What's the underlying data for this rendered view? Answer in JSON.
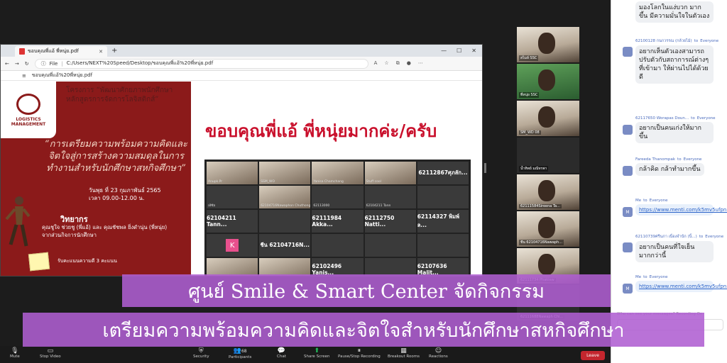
{
  "browser": {
    "tab_title": "ขอบคุณพี่แอ้ พี่หนุ่ย.pdf",
    "address_prefix": "File",
    "address_path": "C:/Users/NEXT%20Speed/Desktop/ขอบคุณพี่แอ้%20พี่หนุ่ย.pdf",
    "pdf_filename": "ขอบคุณพี่แอ้%20พี่หนุ่ย.pdf"
  },
  "slide": {
    "logo_text": "LOGISTICS MANAGEMENT",
    "project_line1": "โครงการ “พัฒนาศักยภาพนักศึกษา",
    "project_line2": "หลักสูตรการจัดการโลจิสติกส์”",
    "event_title": "“การเตรียมความพร้อมความคิดและจิตใจสู่การสร้างความสมดุลในการทำงานสำหรับนักศึกษาสหกิจศึกษา”",
    "date_line1": "วันพุธ ที่ 23 กุมภาพันธ์ 2565",
    "date_line2": "เวลา 09.00-12.00 น.",
    "speaker_label": "วิทยากร",
    "speaker_names": "คุณชูใจ ช่วยชู (พี่แอ้) และ คุณชัชพล ยิ่งดำนุ่น (พี่หนุ่ย)",
    "speaker_org": "จากส่วนกิจการนักศึกษา",
    "cert_text": "รับคะแนนความดี 3 คะแนน",
    "thanks_text": "ขอบคุณพี่แอ้ พี่หนุ่ยมากค่ะ/ครับ"
  },
  "gallery": [
    {
      "label": "Anupk.Pr",
      "kind": "cam"
    },
    {
      "label": "SSM_WO",
      "kind": "cam"
    },
    {
      "label": "Yanisa Chamchang",
      "kind": "cam"
    },
    {
      "label": "Stuff cool",
      "kind": "cam"
    },
    {
      "label": "62112867ศุภลัก...",
      "kind": "text"
    },
    {
      "label": "เอ้ซัม",
      "kind": "dark"
    },
    {
      "label": "62104716Nawaphon Chuthong",
      "kind": "cam"
    },
    {
      "label": "62113000",
      "kind": "dark"
    },
    {
      "label": "62104211 Tann",
      "kind": "dark"
    },
    {
      "label": "",
      "kind": "dark"
    },
    {
      "label": "62104211 Tann...",
      "kind": "text"
    },
    {
      "label": "",
      "kind": "dark"
    },
    {
      "label": "62111984 Akka...",
      "kind": "text"
    },
    {
      "label": "62112750 Natti...",
      "kind": "text"
    },
    {
      "label": "62114327 พิมพ์ล...",
      "kind": "text"
    },
    {
      "label": "K",
      "kind": "k"
    },
    {
      "label": "ชีน 62104716N...",
      "kind": "text"
    },
    {
      "label": "",
      "kind": "dark"
    },
    {
      "label": "",
      "kind": "dark"
    },
    {
      "label": "",
      "kind": "dark"
    },
    {
      "label": "",
      "kind": "cam"
    },
    {
      "label": "",
      "kind": "cam"
    },
    {
      "label": "62102496 Yanis...",
      "kind": "text"
    },
    {
      "label": "",
      "kind": "dark"
    },
    {
      "label": "62107636 Malit...",
      "kind": "text"
    }
  ],
  "video_strip": [
    {
      "name": "สไมล์ SSC",
      "kind": "cam"
    },
    {
      "name": "พี่หนุ่ย SSC",
      "kind": "green"
    },
    {
      "name": "SM_WD 08",
      "kind": "cam"
    },
    {
      "name": "น้ำทิพย์ มณีทรพา",
      "kind": "dark"
    },
    {
      "name": "62111584Sireena Ta...",
      "kind": "cam"
    },
    {
      "name": "ชีน 62104716Nawaph...",
      "kind": "cam"
    },
    {
      "name": "62111734 Phakiew",
      "kind": "cam"
    },
    {
      "name": "62111688Nawaph Chi...",
      "kind": "dark"
    }
  ],
  "chat": [
    {
      "from": "",
      "to": "",
      "text": "มองโลกในแง่บวก มากขึ้น มีความมั่นใจในตัวเอง",
      "type": "text"
    },
    {
      "from": "62100128 กนกวรรณ (กล้วยไม้)",
      "to": "Everyone",
      "text": "อยากเห็นตัวเองสามารถปรับตัวกับสถาการณ์ต่างๆที่เข้ามา ให้ผ่านไปได้ด้วยดี",
      "type": "text"
    },
    {
      "from": "62117650 Worapas Doun...",
      "to": "Everyone",
      "text": "อยากเป็นคนเก่งให้มากขึ้น",
      "type": "text"
    },
    {
      "from": "Fareeda Thanompak",
      "to": "Everyone",
      "text": "กล้าคิด กล้าทำมากขึ้น",
      "type": "text"
    },
    {
      "from": "Me",
      "to": "Everyone",
      "text": "https://www.menti.com/k5mv5ufpn1",
      "type": "link"
    },
    {
      "from": "62110739ศรีนภา เนื่องจำนัก (นิ้...)",
      "to": "Everyone",
      "text": "อยากเป็นคนที่ใจเย็นมากกว่านี้",
      "type": "text"
    },
    {
      "from": "Me",
      "to": "Everyone",
      "text": "https://www.menti.com/k5mv5ufpn1",
      "type": "link"
    }
  ],
  "chat_footer": "Who can see your messages? Recording On",
  "labels": {
    "to_word": "to",
    "me_avatar": "M"
  },
  "toolbar": {
    "mute": "Mute",
    "stop_video": "Stop Video",
    "security": "Security",
    "participants": "Participants",
    "participants_count": "68",
    "chat": "Chat",
    "share_screen": "Share Screen",
    "pause_recording": "Pause/Stop Recording",
    "breakout_rooms": "Breakout Rooms",
    "reactions": "Reactions",
    "leave": "Leave"
  },
  "caption": {
    "line1": "ศูนย์ Smile & Smart Center จัดกิจกรรม",
    "line2": "เตรียมความพร้อมความคิดและจิตใจสำหรับนักศึกษาสหกิจศึกษา"
  },
  "colors": {
    "slide_red": "#8b1a1a",
    "thanks_red": "#c9102c",
    "caption_purple": "#af5fd2",
    "share_green": "#22c55e",
    "leave_red": "#c4262e"
  }
}
